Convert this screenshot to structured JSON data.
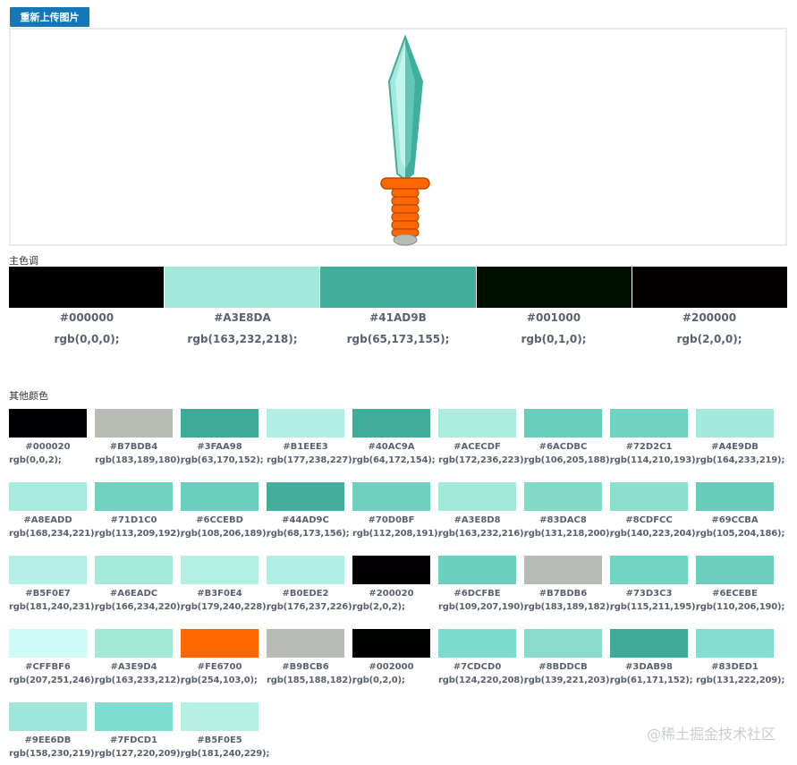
{
  "reupload_button": "重新上传图片",
  "main_section_title": "主色调",
  "other_section_title": "其他颜色",
  "main_colors": [
    {
      "hex": "#000000",
      "rgb": "rgb(0,0,0);",
      "color": "#000000"
    },
    {
      "hex": "#A3E8DA",
      "rgb": "rgb(163,232,218);",
      "color": "#A3E8DA"
    },
    {
      "hex": "#41AD9B",
      "rgb": "rgb(65,173,155);",
      "color": "#41AD9B"
    },
    {
      "hex": "#001000",
      "rgb": "rgb(0,1,0);",
      "color": "#001000"
    },
    {
      "hex": "#200000",
      "rgb": "rgb(2,0,0);",
      "color": "#020000"
    }
  ],
  "other_colors": [
    {
      "hex": "#000020",
      "rgb": "rgb(0,0,2);",
      "color": "#000002"
    },
    {
      "hex": "#B7BDB4",
      "rgb": "rgb(183,189,180);",
      "color": "#B7BDB4"
    },
    {
      "hex": "#3FAA98",
      "rgb": "rgb(63,170,152);",
      "color": "#3FAA98"
    },
    {
      "hex": "#B1EEE3",
      "rgb": "rgb(177,238,227);",
      "color": "#B1EEE3"
    },
    {
      "hex": "#40AC9A",
      "rgb": "rgb(64,172,154);",
      "color": "#40AC9A"
    },
    {
      "hex": "#ACECDF",
      "rgb": "rgb(172,236,223);",
      "color": "#ACECDF"
    },
    {
      "hex": "#6ACDBC",
      "rgb": "rgb(106,205,188);",
      "color": "#6ACDBC"
    },
    {
      "hex": "#72D2C1",
      "rgb": "rgb(114,210,193);",
      "color": "#72D2C1"
    },
    {
      "hex": "#A4E9DB",
      "rgb": "rgb(164,233,219);",
      "color": "#A4E9DB"
    },
    {
      "hex": "#A8EADD",
      "rgb": "rgb(168,234,221);",
      "color": "#A8EADD"
    },
    {
      "hex": "#71D1C0",
      "rgb": "rgb(113,209,192);",
      "color": "#71D1C0"
    },
    {
      "hex": "#6CCEBD",
      "rgb": "rgb(108,206,189);",
      "color": "#6CCEBD"
    },
    {
      "hex": "#44AD9C",
      "rgb": "rgb(68,173,156);",
      "color": "#44AD9C"
    },
    {
      "hex": "#70D0BF",
      "rgb": "rgb(112,208,191);",
      "color": "#70D0BF"
    },
    {
      "hex": "#A3E8D8",
      "rgb": "rgb(163,232,216);",
      "color": "#A3E8D8"
    },
    {
      "hex": "#83DAC8",
      "rgb": "rgb(131,218,200);",
      "color": "#83DAC8"
    },
    {
      "hex": "#8CDFCC",
      "rgb": "rgb(140,223,204);",
      "color": "#8CDFCC"
    },
    {
      "hex": "#69CCBA",
      "rgb": "rgb(105,204,186);",
      "color": "#69CCBA"
    },
    {
      "hex": "#B5F0E7",
      "rgb": "rgb(181,240,231);",
      "color": "#B5F0E7"
    },
    {
      "hex": "#A6EADC",
      "rgb": "rgb(166,234,220);",
      "color": "#A6EADC"
    },
    {
      "hex": "#B3F0E4",
      "rgb": "rgb(179,240,228);",
      "color": "#B3F0E4"
    },
    {
      "hex": "#B0EDE2",
      "rgb": "rgb(176,237,226);",
      "color": "#B0EDE2"
    },
    {
      "hex": "#200020",
      "rgb": "rgb(2,0,2);",
      "color": "#020002"
    },
    {
      "hex": "#6DCFBE",
      "rgb": "rgb(109,207,190);",
      "color": "#6DCFBE"
    },
    {
      "hex": "#B7BDB6",
      "rgb": "rgb(183,189,182);",
      "color": "#B7BDB6"
    },
    {
      "hex": "#73D3C3",
      "rgb": "rgb(115,211,195);",
      "color": "#73D3C3"
    },
    {
      "hex": "#6ECEBE",
      "rgb": "rgb(110,206,190);",
      "color": "#6ECEBE"
    },
    {
      "hex": "#CFFBF6",
      "rgb": "rgb(207,251,246);",
      "color": "#CFFBF6"
    },
    {
      "hex": "#A3E9D4",
      "rgb": "rgb(163,233,212);",
      "color": "#A3E9D4"
    },
    {
      "hex": "#FE6700",
      "rgb": "rgb(254,103,0);",
      "color": "#FE6700"
    },
    {
      "hex": "#B9BCB6",
      "rgb": "rgb(185,188,182);",
      "color": "#B9BCB6"
    },
    {
      "hex": "#002000",
      "rgb": "rgb(0,2,0);",
      "color": "#000200"
    },
    {
      "hex": "#7CDCD0",
      "rgb": "rgb(124,220,208);",
      "color": "#7CDCD0"
    },
    {
      "hex": "#8BDDCB",
      "rgb": "rgb(139,221,203);",
      "color": "#8BDDCB"
    },
    {
      "hex": "#3DAB98",
      "rgb": "rgb(61,171,152);",
      "color": "#3DAB98"
    },
    {
      "hex": "#83DED1",
      "rgb": "rgb(131,222,209);",
      "color": "#83DED1"
    },
    {
      "hex": "#9EE6DB",
      "rgb": "rgb(158,230,219);",
      "color": "#9EE6DB"
    },
    {
      "hex": "#7FDCD1",
      "rgb": "rgb(127,220,209);",
      "color": "#7FDCD1"
    },
    {
      "hex": "#B5F0E5",
      "rgb": "rgb(181,240,229);",
      "color": "#B5F0E5"
    }
  ],
  "watermark": "@稀土掘金技术社区",
  "sword_colors": {
    "blade_light": "#A3E8DA",
    "blade_dark": "#41AD9B",
    "blade_highlight": "#CFFBF6",
    "handle": "#FE6700",
    "pommel": "#B9BCB6"
  }
}
